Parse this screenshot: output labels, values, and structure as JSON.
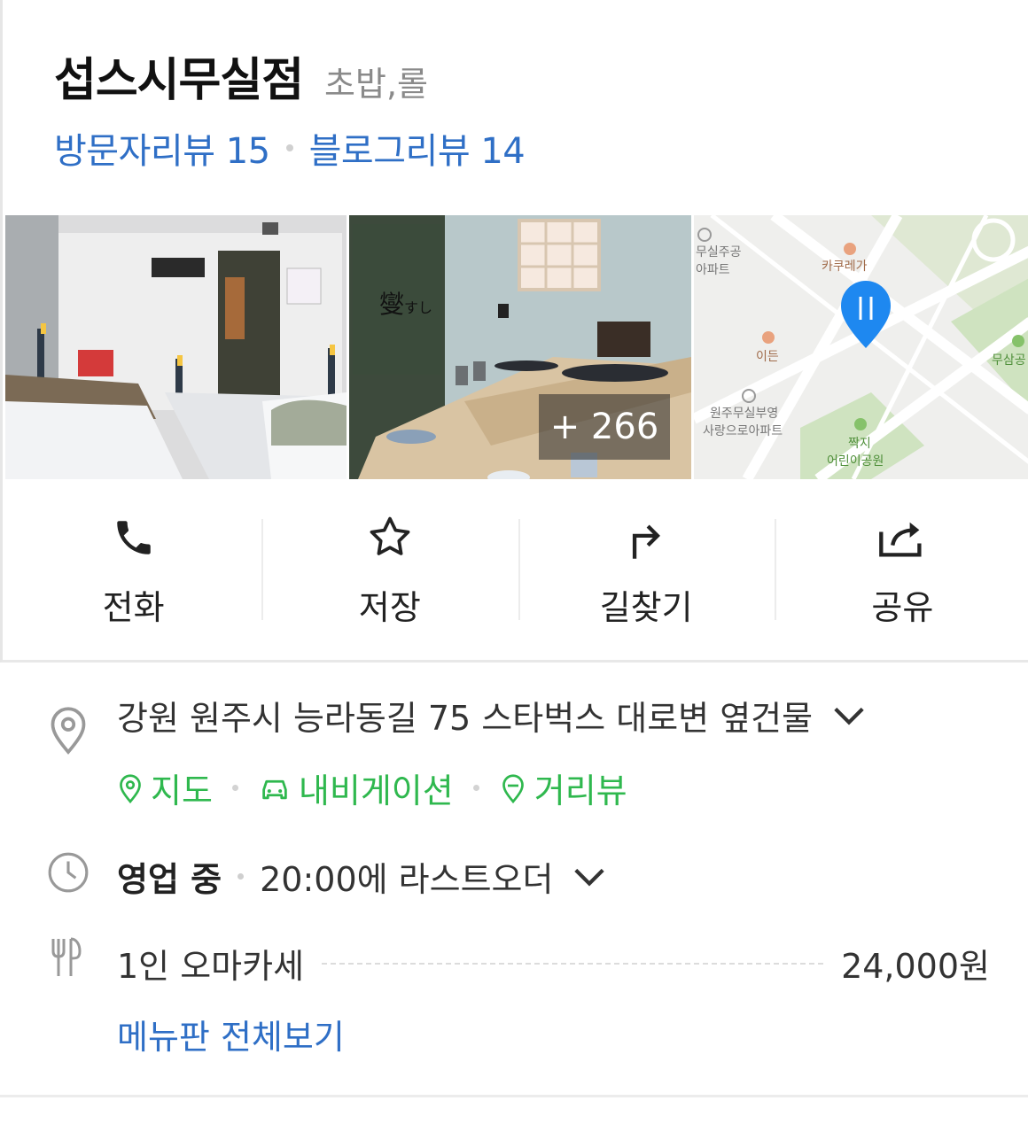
{
  "place": {
    "name": "섭스시무실점",
    "category": "초밥,롤",
    "visitor_reviews": "방문자리뷰 15",
    "blog_reviews": "블로그리뷰 14"
  },
  "photos": {
    "more_count": "+ 266",
    "map_labels": [
      "무실주공",
      "아파트",
      "카쿠레가",
      "이든",
      "원주무실부영",
      "사랑으로아파트",
      "짝지",
      "어린이공원",
      "무삼공"
    ]
  },
  "actions": [
    {
      "label": "전화",
      "icon": "phone-icon"
    },
    {
      "label": "저장",
      "icon": "star-icon"
    },
    {
      "label": "길찾기",
      "icon": "directions-icon"
    },
    {
      "label": "공유",
      "icon": "share-icon"
    }
  ],
  "address": {
    "text": "강원 원주시 능라동길 75 스타벅스 대로변 옆건물",
    "links": [
      "지도",
      "내비게이션",
      "거리뷰"
    ]
  },
  "hours": {
    "status": "영업 중",
    "detail": "20:00에 라스트오더"
  },
  "menu": {
    "item_name": "1인 오마카세",
    "item_price": "24,000원",
    "view_all": "메뉴판 전체보기"
  },
  "colors": {
    "link_blue": "#2f6fc6",
    "link_green": "#2fb84e",
    "map_pin": "#1e88f0"
  }
}
